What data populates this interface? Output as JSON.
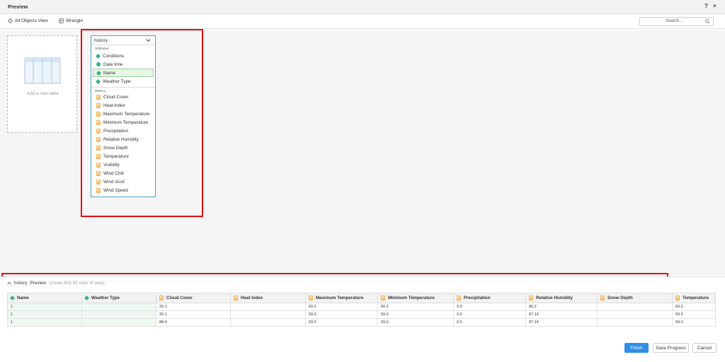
{
  "window": {
    "title": "Preview",
    "help_label": "?",
    "close_label": "×"
  },
  "toolbar": {
    "all_objects_label": "All Objects View",
    "wrangle_label": "Wrangle",
    "search_placeholder": "Search..."
  },
  "canvas": {
    "add_table_label": "Add a new table"
  },
  "table_card": {
    "name": "history",
    "attributes_header": "Attributes",
    "attributes": [
      {
        "label": "Conditions",
        "icon": "attribute-icon"
      },
      {
        "label": "Date time",
        "icon": "clock-icon"
      },
      {
        "label": "Name",
        "icon": "attribute-icon",
        "selected": true
      },
      {
        "label": "Weather Type",
        "icon": "attribute-icon"
      }
    ],
    "metrics_header": "Metrics",
    "metrics": [
      "Cloud Cover",
      "Heat Index",
      "Maximum Temperature",
      "Minimum Temperature",
      "Precipitation",
      "Relative Humidity",
      "Snow Depth",
      "Temperature",
      "Visibility",
      "Wind Chill",
      "Wind Gust",
      "Wind Speed"
    ]
  },
  "preview": {
    "table_name": "history",
    "title": "Preview",
    "subtitle": "(shows first 50 rows of data)",
    "columns": [
      {
        "label": "Name",
        "type": "attribute"
      },
      {
        "label": "Weather Type",
        "type": "attribute"
      },
      {
        "label": "Cloud Cover",
        "type": "metric"
      },
      {
        "label": "Heat Index",
        "type": "metric"
      },
      {
        "label": "Maximum Temperature",
        "type": "metric"
      },
      {
        "label": "Minimum Temperature",
        "type": "metric"
      },
      {
        "label": "Precipitation",
        "type": "metric"
      },
      {
        "label": "Relative Humidity",
        "type": "metric"
      },
      {
        "label": "Snow Depth",
        "type": "metric"
      },
      {
        "label": "Temperature",
        "type": "metric"
      }
    ],
    "rows": [
      [
        "1",
        "",
        "26.1",
        "",
        "60.2",
        "60.2",
        "0.0",
        "86.2",
        "",
        "60.2"
      ],
      [
        "1",
        "",
        "26.1",
        "",
        "59.0",
        "59.0",
        "0.0",
        "87.14",
        "",
        "59.0"
      ],
      [
        "1",
        "",
        "88.4",
        "",
        "59.0",
        "59.0",
        "0.0",
        "87.14",
        "",
        "59.0"
      ]
    ]
  },
  "footer": {
    "finish_label": "Finish",
    "save_label": "Save Progress",
    "cancel_label": "Cancel"
  },
  "colors": {
    "accent": "#2f8ee6",
    "attribute": "#3bb08a",
    "metric": "#f0a23b",
    "highlight": "#e30f0f"
  }
}
